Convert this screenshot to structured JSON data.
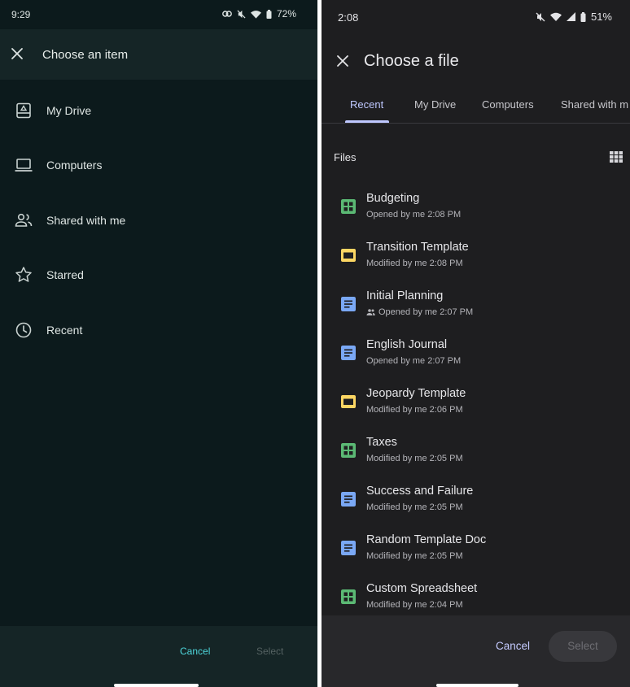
{
  "left": {
    "status": {
      "time": "9:29",
      "battery": "72%"
    },
    "header": {
      "title": "Choose an item"
    },
    "items": [
      {
        "label": "My Drive",
        "icon": "drive-icon"
      },
      {
        "label": "Computers",
        "icon": "laptop-icon"
      },
      {
        "label": "Shared with me",
        "icon": "people-icon"
      },
      {
        "label": "Starred",
        "icon": "star-icon"
      },
      {
        "label": "Recent",
        "icon": "clock-icon"
      }
    ],
    "footer": {
      "cancel": "Cancel",
      "select": "Select"
    }
  },
  "right": {
    "status": {
      "time": "2:08",
      "battery": "51%"
    },
    "header": {
      "title": "Choose a file"
    },
    "tabs": [
      {
        "label": "Recent",
        "active": true
      },
      {
        "label": "My Drive"
      },
      {
        "label": "Computers"
      },
      {
        "label": "Shared with m"
      }
    ],
    "section_label": "Files",
    "files": [
      {
        "name": "Budgeting",
        "meta": "Opened by me 2:08 PM",
        "type": "sheets"
      },
      {
        "name": "Transition Template",
        "meta": "Modified by me 2:08 PM",
        "type": "slides"
      },
      {
        "name": "Initial Planning",
        "meta": "Opened by me 2:07 PM",
        "type": "docs",
        "shared": true
      },
      {
        "name": "English Journal",
        "meta": "Opened by me 2:07 PM",
        "type": "docs"
      },
      {
        "name": "Jeopardy Template",
        "meta": "Modified by me 2:06 PM",
        "type": "slides"
      },
      {
        "name": "Taxes",
        "meta": "Modified by me 2:05 PM",
        "type": "sheets"
      },
      {
        "name": "Success and Failure",
        "meta": "Modified by me 2:05 PM",
        "type": "docs"
      },
      {
        "name": "Random Template Doc",
        "meta": "Modified by me 2:05 PM",
        "type": "docs"
      },
      {
        "name": "Custom Spreadsheet",
        "meta": "Modified by me 2:04 PM",
        "type": "sheets"
      }
    ],
    "footer": {
      "cancel": "Cancel",
      "select": "Select"
    }
  },
  "colors": {
    "sheets": "#5bb974",
    "slides": "#fcd663",
    "docs": "#7aa8f5",
    "left_accent": "#4ed7dc",
    "right_accent": "#bfc8ff"
  }
}
